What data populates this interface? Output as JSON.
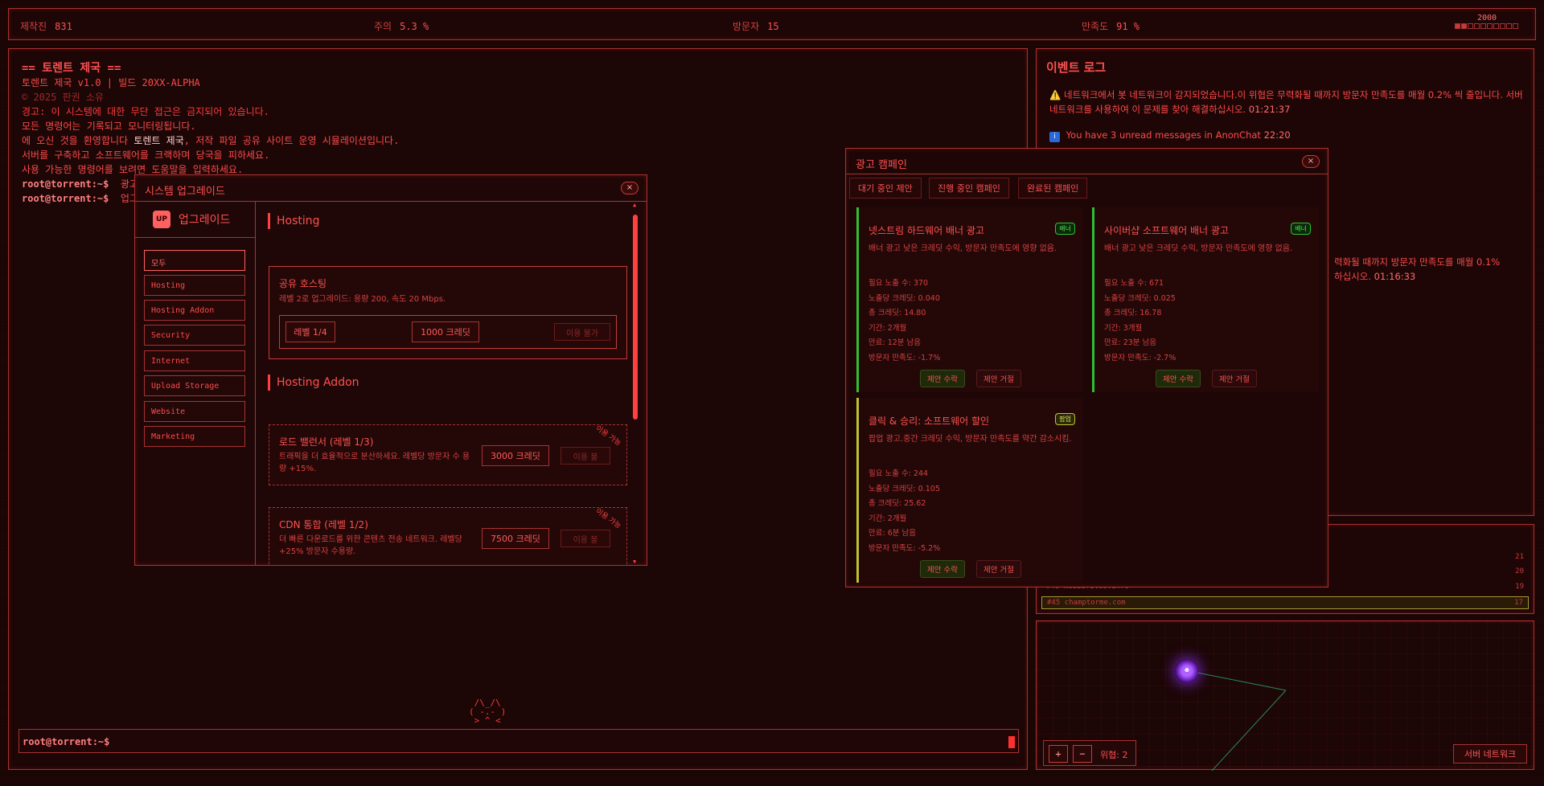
{
  "topbar": {
    "stats": [
      {
        "label": "제작진",
        "value": "831"
      },
      {
        "label": "주의",
        "value": "5.3 %"
      },
      {
        "label": "방문자",
        "value": "15"
      },
      {
        "label": "만족도",
        "value": "91 %"
      }
    ],
    "mini_value": "2000",
    "mini_level": 0.2
  },
  "terminal": {
    "title": "== 토렌트 제국 ==",
    "version": "토렌트 제국 v1.0 | 빌드 20XX-ALPHA",
    "copyright": "© 2025 판권 소유",
    "warning": "경고: 이 시스템에 대한 무단 접근은 금지되어 있습니다.",
    "line_monitor": "모든 명령어는 기록되고 모니터링됩니다.",
    "welcome_a": "에 오신 것을 환영합니다 ",
    "welcome_b": "토렌트 제국",
    "welcome_c": ", 저작 파일 공유 사이트 운영 시뮬레이션입니다.",
    "line_build": "서버를 구축하고 소프트웨어를 크랙하며 당국을 피하세요.",
    "line_help": "사용 가능한 명령어를 보려면 도움말을 입력하세요.",
    "prompt": "root@torrent:~$",
    "cmd1": "광고",
    "cmd2": "업그레",
    "ascii_art": " /\\_/\\\n( -.- )\n > ^ <"
  },
  "upgrade": {
    "title": "시스템 업그레이드",
    "close": "×",
    "logo_badge": "UP",
    "logo_text": "업그레이드",
    "categories": [
      "모두",
      "Hosting",
      "Hosting Addon",
      "Security",
      "Internet",
      "Upload Storage",
      "Website",
      "Marketing"
    ],
    "sections": {
      "hosting": "Hosting",
      "hosting_addon": "Hosting Addon"
    },
    "items": [
      {
        "title": "공유 호스팅",
        "desc": "레벨 2로 업그레이드: 용량 200, 속도 20 Mbps.",
        "level": "레벨 1/4",
        "price": "1000 크레딧",
        "action": "이용 불가"
      },
      {
        "title": "로드 밸런서 (레벨 1/3)",
        "desc": "트래픽을 더 효율적으로 분산하세요. 레벨당 방문자 수 용량 +15%.",
        "price": "3000 크레딧",
        "action": "이용 불",
        "ribbon": "이용 가능"
      },
      {
        "title": "CDN 통합 (레벨 1/2)",
        "desc": "더 빠른 다운로드를 위한 콘텐츠 전송 네트워크. 레벨당 +25% 방문자 수용량.",
        "price": "7500 크레딧",
        "action": "이용 불",
        "ribbon": "이용 가능"
      }
    ]
  },
  "eventlog": {
    "title": "이벤트 로그",
    "events": [
      {
        "icon": "⚠️",
        "text": "네트워크에서 봇 네트워크이 감지되었습니다.이 위협은 무력화될 때까지 방문자 만족도를 매월 0.2% 씩 줄입니다. 서버 네트워크를 사용하여 이 문제를 찾아 해결하십시오.",
        "time": "01:21:37"
      },
      {
        "icon": "i",
        "text": "You have 3 unread messages in AnonChat",
        "time": "22:20"
      },
      {
        "text": "력화될 때까지 방문자 만족도를 매월 0.1%",
        "time": ""
      },
      {
        "text": "하십시오.",
        "time": "01:16:33"
      }
    ]
  },
  "sites": [
    {
      "rank": "",
      "name": "",
      "count": "21"
    },
    {
      "rank": "",
      "name": "",
      "count": "20"
    },
    {
      "rank": "#46",
      "name": "mediafiles.info",
      "count": "19"
    },
    {
      "rank": "#45",
      "name": "champtorme.com",
      "count": "17"
    }
  ],
  "netmap": {
    "zoom_in": "+",
    "zoom_out": "−",
    "threat_label": "위협: 2",
    "server_button": "서버 네트워크"
  },
  "ad": {
    "title": "광고 캠페인",
    "close": "×",
    "tabs": [
      "대기 중인 제안",
      "진행 중인 캠페인",
      "완료된 캠페인"
    ],
    "cards": [
      {
        "title": "넷스트림 하드웨어 배너 광고",
        "badge": "배너",
        "desc": "배너 광고 낮은 크레딧 수익, 방문자 만족도에 영향 없음.",
        "stats": [
          "필요 노출 수: 370",
          "노출당 크레딧: 0.040",
          "총 크레딧: 14.80",
          "기간: 2개월",
          "만료: 12분 남음",
          "방문자 만족도: -1.7%"
        ],
        "accept": "제안 수락",
        "reject": "제안 거절"
      },
      {
        "title": "사이버샵 소프트웨어 배너 광고",
        "badge": "배너",
        "desc": "배너 광고 낮은 크레딧 수익, 방문자 만족도에 영향 없음.",
        "stats": [
          "필요 노출 수: 671",
          "노출당 크레딧: 0.025",
          "총 크레딧: 16.78",
          "기간: 3개월",
          "만료: 23분 남음",
          "방문자 만족도: -2.7%"
        ],
        "accept": "제안 수락",
        "reject": "제안 거절"
      },
      {
        "title": "클릭 & 승리: 소프트웨어 할인",
        "badge": "팝업",
        "desc": "팝업 광고.중간 크레딧 수익, 방문자 만족도를 약간 감소시킴.",
        "stats": [
          "필요 노출 수: 244",
          "노출당 크레딧: 0.105",
          "총 크레딧: 25.62",
          "기간: 2개월",
          "만료: 6분 남음",
          "방문자 만족도: -5.2%"
        ],
        "accept": "제안 수락",
        "reject": "제안 거절"
      }
    ]
  }
}
